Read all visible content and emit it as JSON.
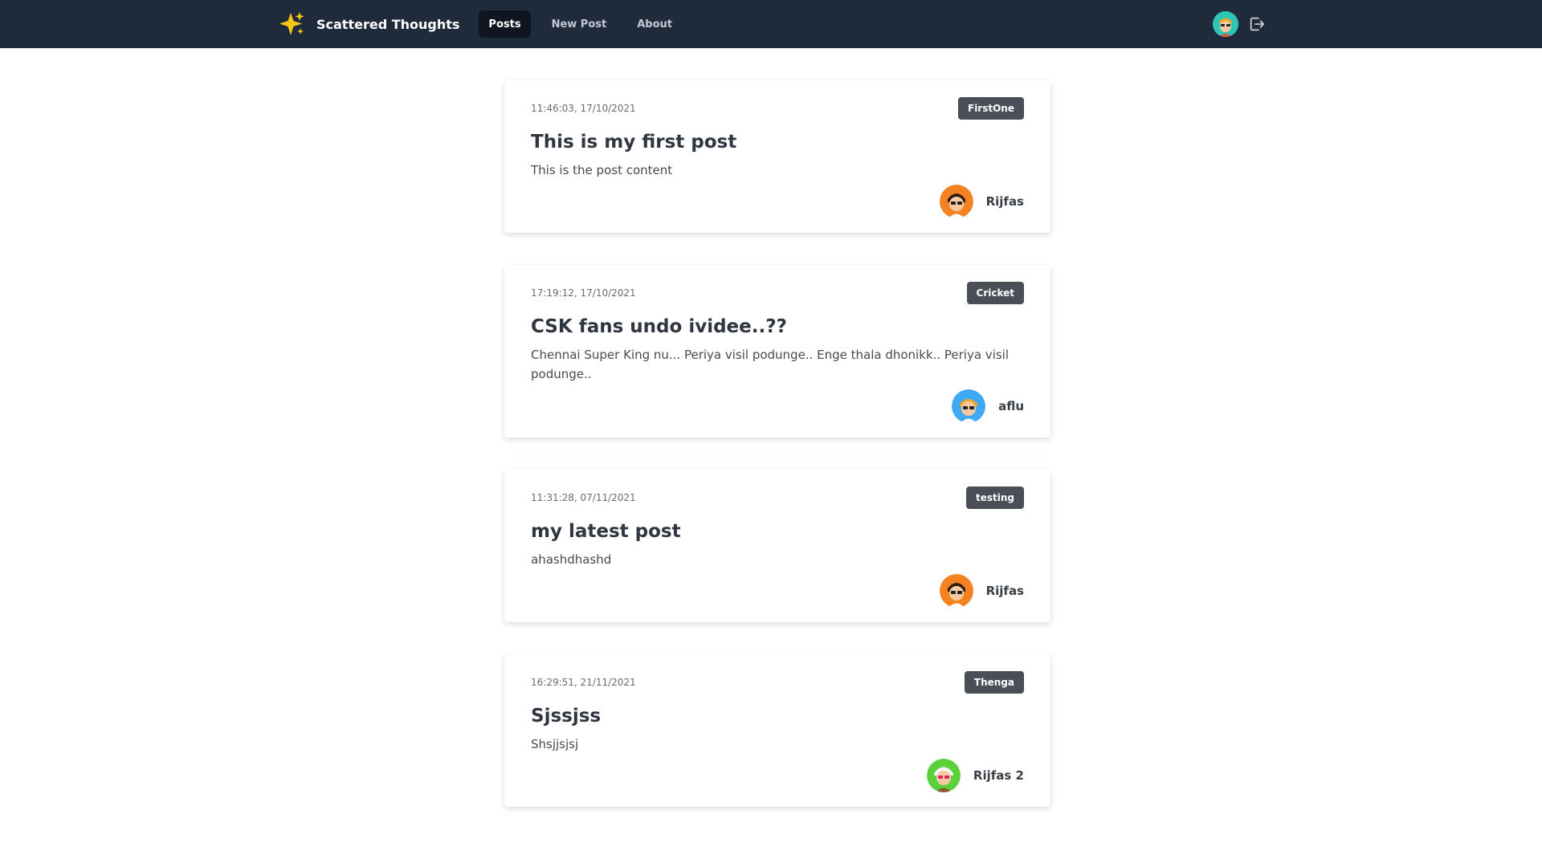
{
  "nav": {
    "brand": "Scattered Thoughts",
    "items": [
      {
        "label": "Posts",
        "active": true
      },
      {
        "label": "New Post",
        "active": false
      },
      {
        "label": "About",
        "active": false
      }
    ],
    "brand_icon": "sparkles-icon",
    "logout_icon": "logout-icon"
  },
  "posts": [
    {
      "timestamp": "11:46:03, 17/10/2021",
      "tag": "FirstOne",
      "title": "This is my first post",
      "content": "This is the post content",
      "author": "Rijfas",
      "avatar_color": "#f58220"
    },
    {
      "timestamp": "17:19:12, 17/10/2021",
      "tag": "Cricket",
      "title": "CSK fans undo ividee..??",
      "content": "Chennai Super King nu... Periya visil podunge.. Enge thala dhonikk.. Periya visil podunge..",
      "author": "aflu",
      "avatar_color": "#3fa9f5"
    },
    {
      "timestamp": "11:31:28, 07/11/2021",
      "tag": "testing",
      "title": "my latest post",
      "content": "ahashdhashd",
      "author": "Rijfas",
      "avatar_color": "#f58220"
    },
    {
      "timestamp": "16:29:51, 21/11/2021",
      "tag": "Thenga",
      "title": "Sjssjss",
      "content": "Shsjjsjsj",
      "author": "Rijfas 2",
      "avatar_color": "#5ad13a"
    }
  ],
  "colors": {
    "navbar": "#1f2a3b",
    "tag_bg": "#4a4f57",
    "nav_avatar": "#2ec4b6"
  }
}
